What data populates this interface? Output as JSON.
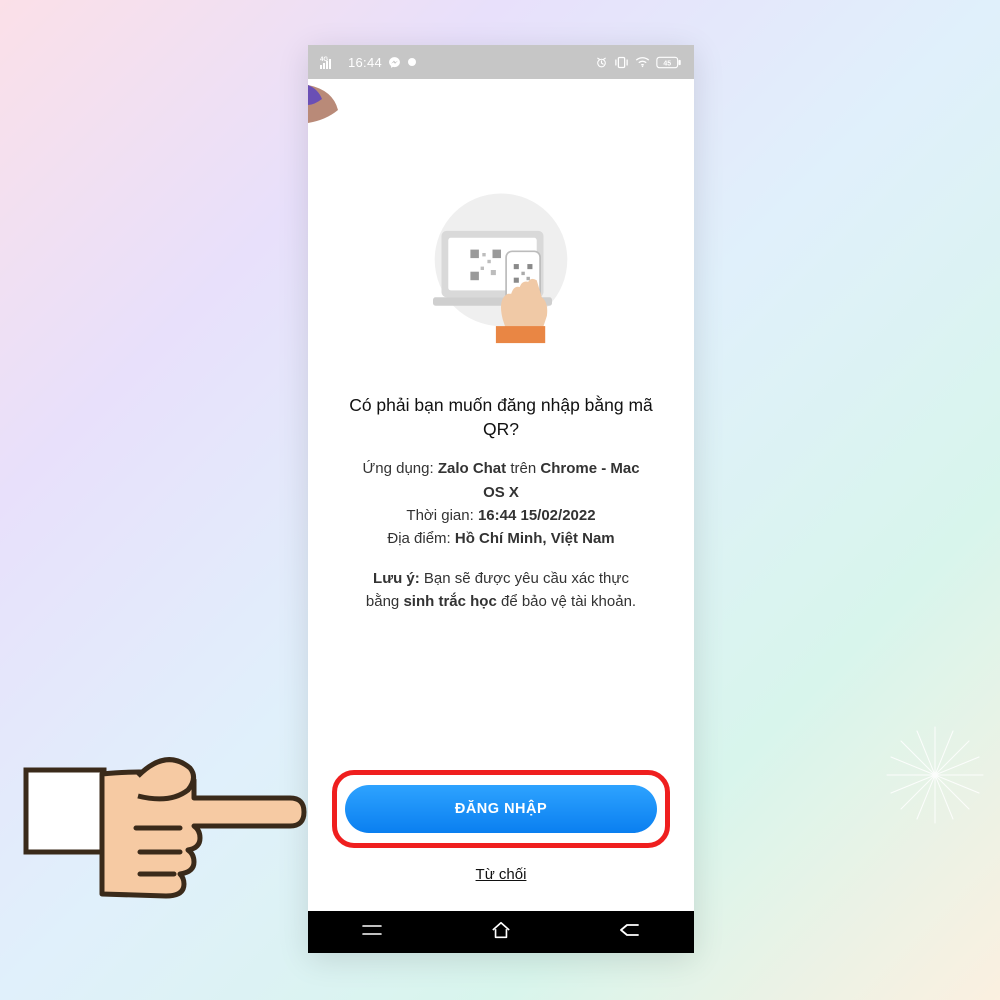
{
  "statusbar": {
    "network_label": "4G",
    "time": "16:44",
    "battery_text": "45"
  },
  "screen": {
    "title_line1": "Có phải bạn muốn đăng nhập bằng mã",
    "title_line2": "QR?",
    "app_label": "Ứng dụng:",
    "app_name": "Zalo Chat",
    "app_join": "trên",
    "browser_line1": "Chrome - Mac",
    "browser_line2": "OS X",
    "time_label": "Thời gian:",
    "time_value": "16:44 15/02/2022",
    "place_label": "Địa điểm:",
    "place_value": "Hồ Chí Minh, Việt Nam",
    "note_label": "Lưu ý:",
    "note_text1": "Bạn sẽ được yêu cầu xác thực",
    "note_text2a": "bằng",
    "note_text2b": "sinh trắc học",
    "note_text2c": "để bảo vệ tài khoản."
  },
  "actions": {
    "login": "ĐĂNG NHẬP",
    "decline": "Từ chối"
  }
}
